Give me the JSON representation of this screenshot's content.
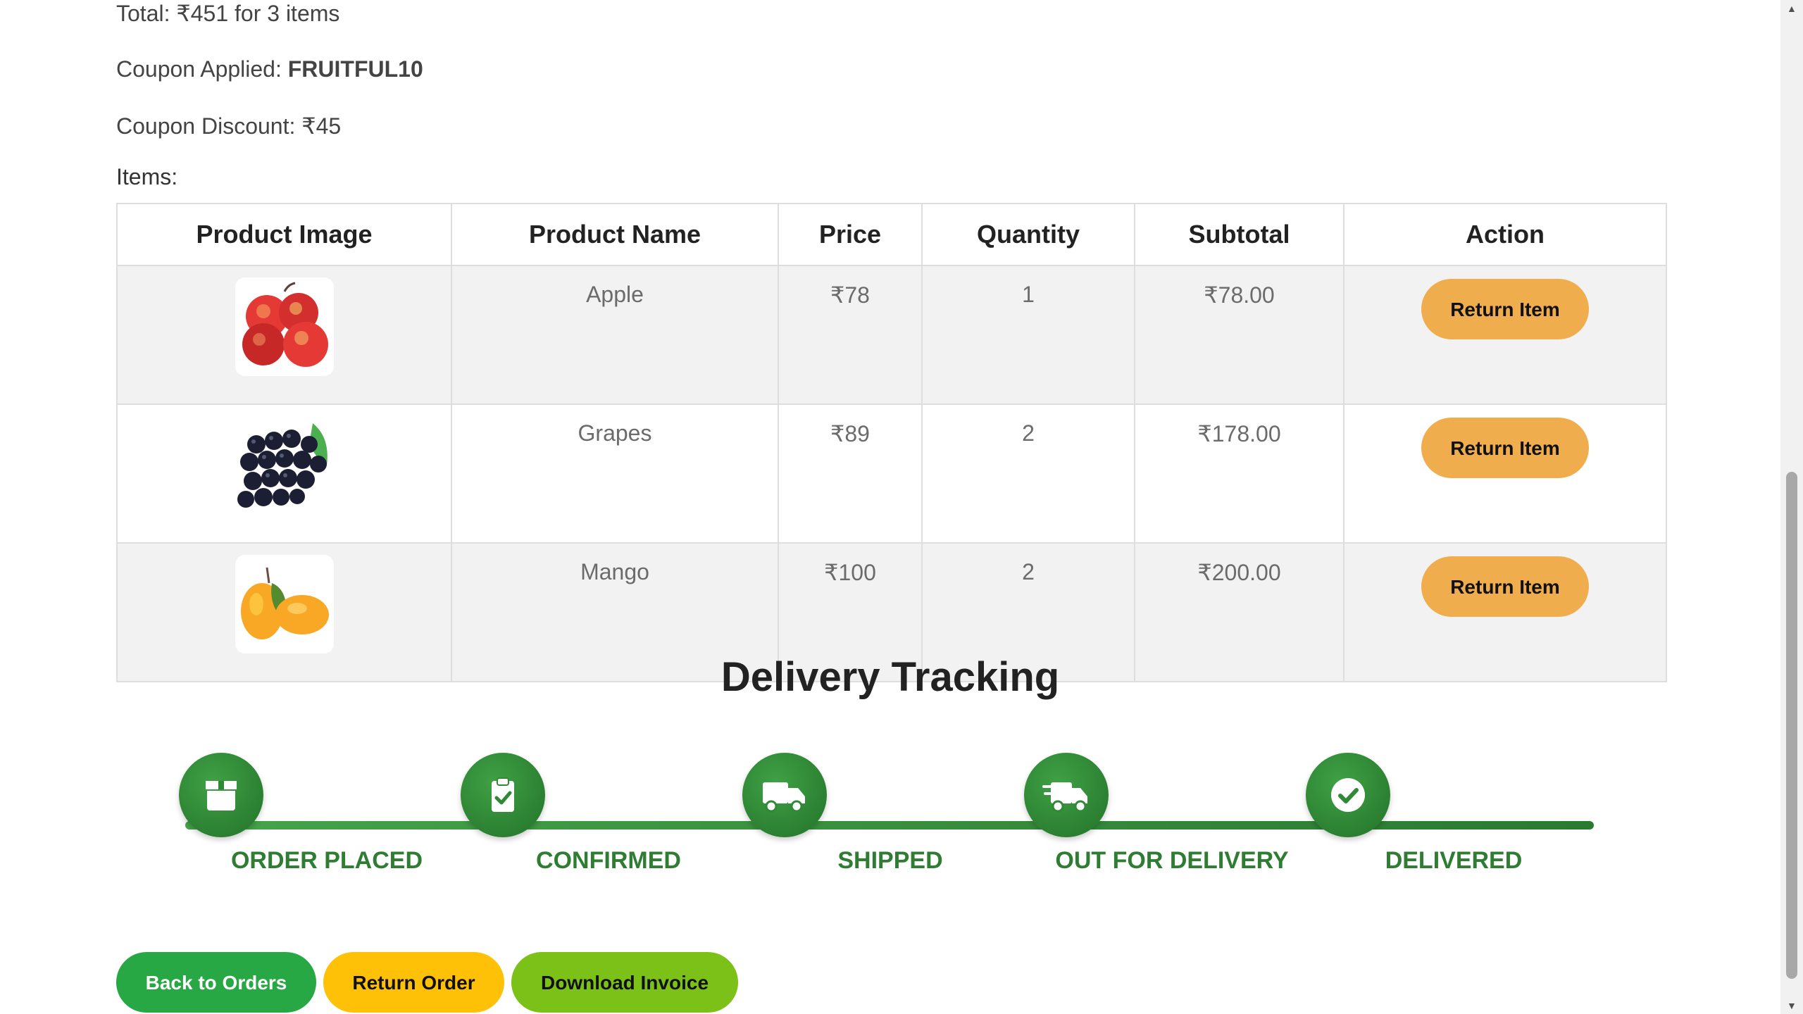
{
  "summary": {
    "total": "Total: ₹451 for 3 items",
    "coupon_prefix": "Coupon Applied: ",
    "coupon_code": "FRUITFUL10",
    "discount": "Coupon Discount: ₹45",
    "items_label": "Items:"
  },
  "table": {
    "headers": [
      "Product Image",
      "Product Name",
      "Price",
      "Quantity",
      "Subtotal",
      "Action"
    ],
    "rows": [
      {
        "name": "Apple",
        "price": "₹78",
        "quantity": "1",
        "subtotal": "₹78.00",
        "action": "Return Item"
      },
      {
        "name": "Grapes",
        "price": "₹89",
        "quantity": "2",
        "subtotal": "₹178.00",
        "action": "Return Item"
      },
      {
        "name": "Mango",
        "price": "₹100",
        "quantity": "2",
        "subtotal": "₹200.00",
        "action": "Return Item"
      }
    ]
  },
  "tracking": {
    "title": "Delivery Tracking",
    "steps": [
      {
        "label": "ORDER PLACED",
        "icon": "box-icon"
      },
      {
        "label": "CONFIRMED",
        "icon": "clipboard-check-icon"
      },
      {
        "label": "SHIPPED",
        "icon": "truck-icon"
      },
      {
        "label": "OUT FOR DELIVERY",
        "icon": "fast-truck-icon"
      },
      {
        "label": "DELIVERED",
        "icon": "check-circle-icon"
      }
    ],
    "color": "#2e7d32"
  },
  "buttons": {
    "back": "Back to Orders",
    "return_order": "Return Order",
    "download": "Download Invoice"
  },
  "colors": {
    "back": "#28a745",
    "return_order": "#ffc107",
    "download": "#7cc118",
    "return_item": "#f0ad4e"
  }
}
